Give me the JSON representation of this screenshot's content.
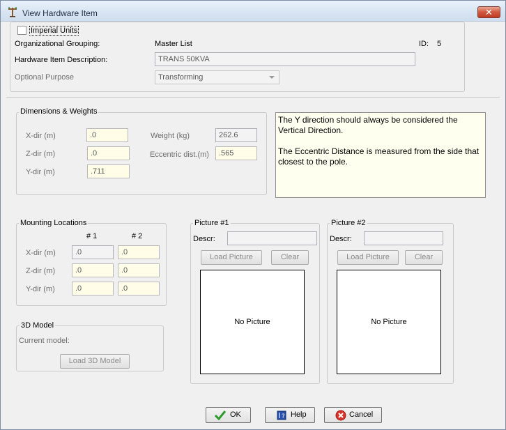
{
  "window": {
    "title": "View Hardware Item",
    "close_label": "✕"
  },
  "header": {
    "imperial_units_label": "Imperial Units",
    "imperial_units_checked": false,
    "org_grouping_label": "Organizational Grouping:",
    "org_grouping_value": "Master List",
    "id_label": "ID:",
    "id_value": "5",
    "description_label": "Hardware Item Description:",
    "description_value": "TRANS 50KVA",
    "optional_purpose_label": "Optional Purpose",
    "optional_purpose_value": "Transforming"
  },
  "dimensions": {
    "title": "Dimensions & Weights",
    "xdir_label": "X-dir (m)",
    "xdir_value": ".0",
    "zdir_label": "Z-dir (m)",
    "zdir_value": ".0",
    "ydir_label": "Y-dir (m)",
    "ydir_value": ".711",
    "weight_label": "Weight (kg)",
    "weight_value": "262.6",
    "ecc_label": "Eccentric dist.(m)",
    "ecc_value": ".565"
  },
  "note": {
    "line1": "The Y direction should always be considered the Vertical Direction.",
    "line2": "The Eccentric Distance is measured from the side that closest to the pole."
  },
  "mounting": {
    "title": "Mounting Locations",
    "col1": "# 1",
    "col2": "# 2",
    "xdir_label": "X-dir (m)",
    "zdir_label": "Z-dir (m)",
    "ydir_label": "Y-dir (m)",
    "x1": ".0",
    "x2": ".0",
    "z1": ".0",
    "z2": ".0",
    "y1": ".0",
    "y2": ".0"
  },
  "model3d": {
    "title": "3D Model",
    "current_label": "Current model:",
    "load_label": "Load 3D Model"
  },
  "picture1": {
    "title": "Picture #1",
    "descr_label": "Descr:",
    "descr_value": "",
    "load_label": "Load Picture",
    "clear_label": "Clear",
    "placeholder": "No Picture"
  },
  "picture2": {
    "title": "Picture #2",
    "descr_label": "Descr:",
    "descr_value": "",
    "load_label": "Load Picture",
    "clear_label": "Clear",
    "placeholder": "No Picture"
  },
  "footer": {
    "ok_label": "OK",
    "help_label": "Help",
    "cancel_label": "Cancel"
  }
}
